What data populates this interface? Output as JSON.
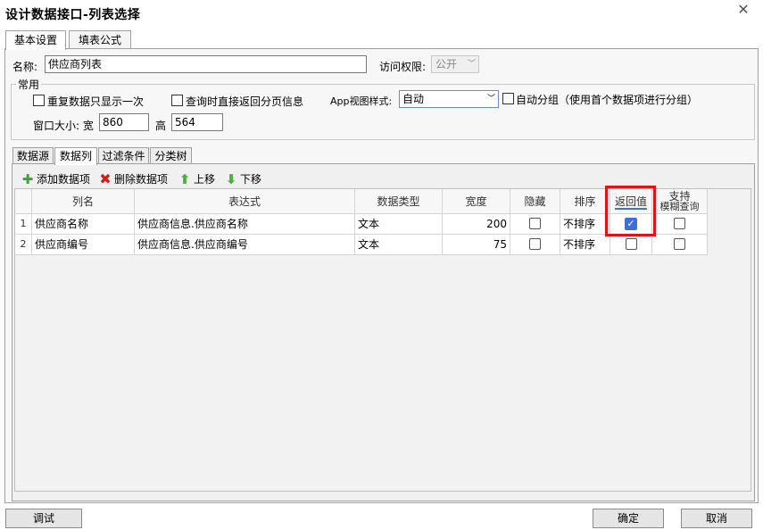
{
  "window": {
    "title": "设计数据接口-列表选择"
  },
  "tabs": [
    "基本设置",
    "填表公式"
  ],
  "form": {
    "name_label": "名称:",
    "name_value": "供应商列表",
    "access_label": "访问权限:",
    "access_value": "公开"
  },
  "common": {
    "legend": "常用",
    "dedupe_label": "重复数据只显示一次",
    "direct_page_label": "查询时直接返回分页信息",
    "app_view_label": "App视图样式:",
    "app_view_value": "自动",
    "auto_group_label": "自动分组（使用首个数据项进行分组）",
    "window_size_label": "窗口大小: 宽",
    "width_value": "860",
    "height_label": "高",
    "height_value": "564"
  },
  "subtabs": [
    "数据源",
    "数据列",
    "过滤条件",
    "分类树"
  ],
  "toolbar": {
    "add": "添加数据项",
    "delete": "删除数据项",
    "up": "上移",
    "down": "下移"
  },
  "table": {
    "headers": [
      "列名",
      "表达式",
      "数据类型",
      "宽度",
      "隐藏",
      "排序",
      "返回值",
      "支持",
      "模糊查询"
    ],
    "rows": [
      {
        "num": "1",
        "name": "供应商名称",
        "expr": "供应商信息.供应商名称",
        "type": "文本",
        "width": "200",
        "hidden": false,
        "sort": "不排序",
        "return": true,
        "fuzzy": false
      },
      {
        "num": "2",
        "name": "供应商编号",
        "expr": "供应商信息.供应商编号",
        "type": "文本",
        "width": "75",
        "hidden": false,
        "sort": "不排序",
        "return": false,
        "fuzzy": false
      }
    ]
  },
  "buttons": {
    "debug": "调试",
    "ok": "确定",
    "cancel": "取消"
  },
  "colors": {
    "highlight": "#e0131b",
    "checked": "#3c6fd8"
  },
  "icons": {
    "close": "close-icon",
    "add": "plus-icon",
    "delete": "x-icon",
    "up": "arrow-up-icon",
    "down": "arrow-down-icon"
  }
}
